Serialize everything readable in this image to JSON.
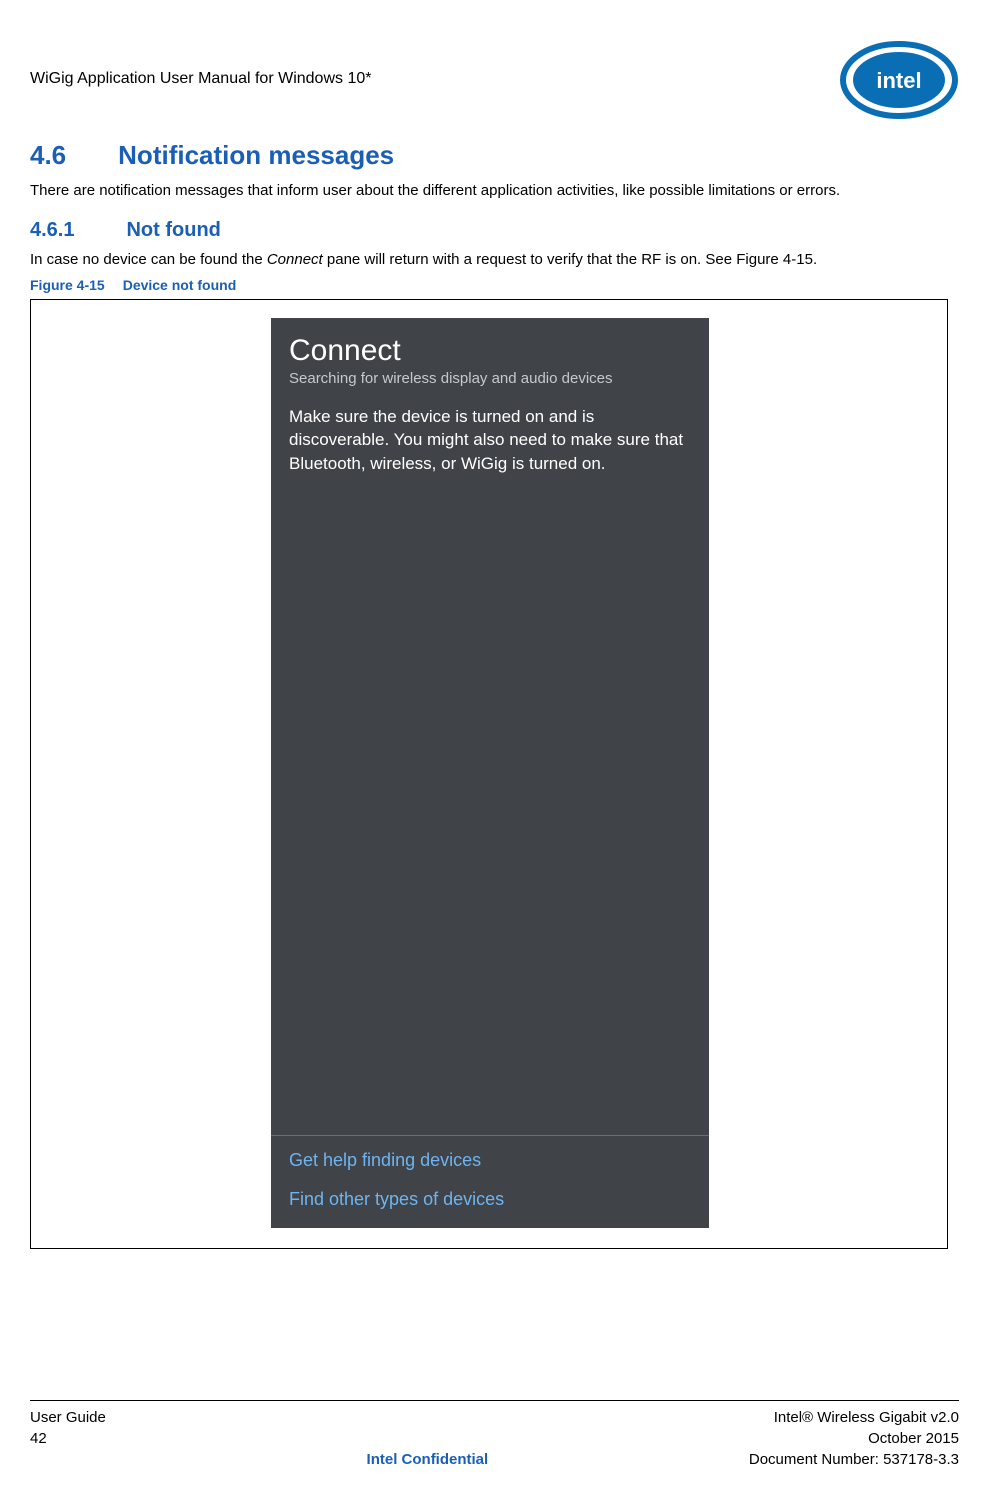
{
  "header": {
    "doc_title": "WiGig Application User Manual for Windows 10*",
    "logo_name": "intel-logo"
  },
  "section_46": {
    "num": "4.6",
    "title": "Notification messages",
    "body": "There are notification messages that inform user about the different application activities, like possible limitations or errors."
  },
  "section_461": {
    "num": "4.6.1",
    "title": "Not found",
    "body_pre": "In case no device can be found the ",
    "body_em": "Connect",
    "body_post": " pane will return with a request to verify that the RF is on. See Figure 4-15."
  },
  "figure": {
    "id": "Figure 4-15",
    "title": "Device not found"
  },
  "connect_pane": {
    "title": "Connect",
    "subtitle": "Searching for wireless display and audio devices",
    "body_msg": "Make sure the device is turned on and is discoverable. You might also need to make sure that Bluetooth, wireless, or WiGig is turned on.",
    "help_link": "Get help finding devices",
    "other_link": "Find other types of devices"
  },
  "footer": {
    "left_r1": "",
    "left_r2": "User Guide",
    "left_r3": "42",
    "center_r3": "Intel Confidential",
    "right_r1": "Intel® Wireless Gigabit v2.0",
    "right_r2": "October 2015",
    "right_r3": "Document Number: 537178-3.3"
  }
}
